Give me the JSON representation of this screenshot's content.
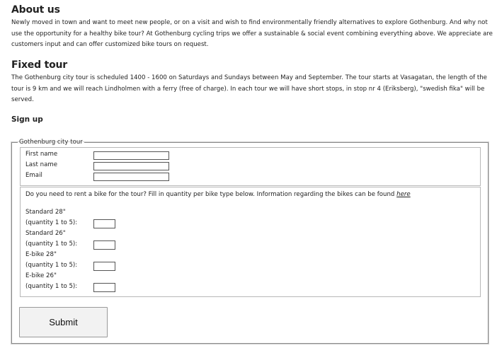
{
  "about": {
    "heading": "About us",
    "text": "Newly moved in town and want to meet new people, or on a visit and wish to find environmentally friendly alternatives to explore Gothenburg. And why not use the opportunity for a healthy bike tour? At Gothenburg cycling trips we offer a sustainable & social event combining everything above. We appreciate are customers input and can offer customized bike tours on request."
  },
  "fixed_tour": {
    "heading": "Fixed tour",
    "text": "The Gothenburg city tour is scheduled 1400 - 1600 on Saturdays and Sundays between May and September. The tour starts at Vasagatan, the length of the tour is 9 km and we will reach Lindholmen with a ferry (free of charge). In each tour we will have short stops, in stop nr 4 (Eriksberg), \"swedish fika\" will be served."
  },
  "signup": {
    "heading": "Sign up",
    "legend": "Gothenburg city tour",
    "fields": {
      "first_name_label": "First name",
      "last_name_label": "Last name",
      "email_label": "Email",
      "first_name_value": "",
      "last_name_value": "",
      "email_value": ""
    },
    "bikes": {
      "question": "Do you need to rent a bike for the tour? Fill in quantity per bike type below. Information regarding the bikes can be found ",
      "link_text": "here",
      "items": [
        {
          "name": "Standard 28\"",
          "qty_label": "(quantity 1 to 5):",
          "value": ""
        },
        {
          "name": "Standard 26\"",
          "qty_label": "(quantity 1 to 5):",
          "value": ""
        },
        {
          "name": "E-bike 28\"",
          "qty_label": "(quantity 1 to 5):",
          "value": ""
        },
        {
          "name": "E-bike 26\"",
          "qty_label": "(quantity 1 to 5):",
          "value": ""
        }
      ]
    },
    "submit_label": "Submit"
  }
}
